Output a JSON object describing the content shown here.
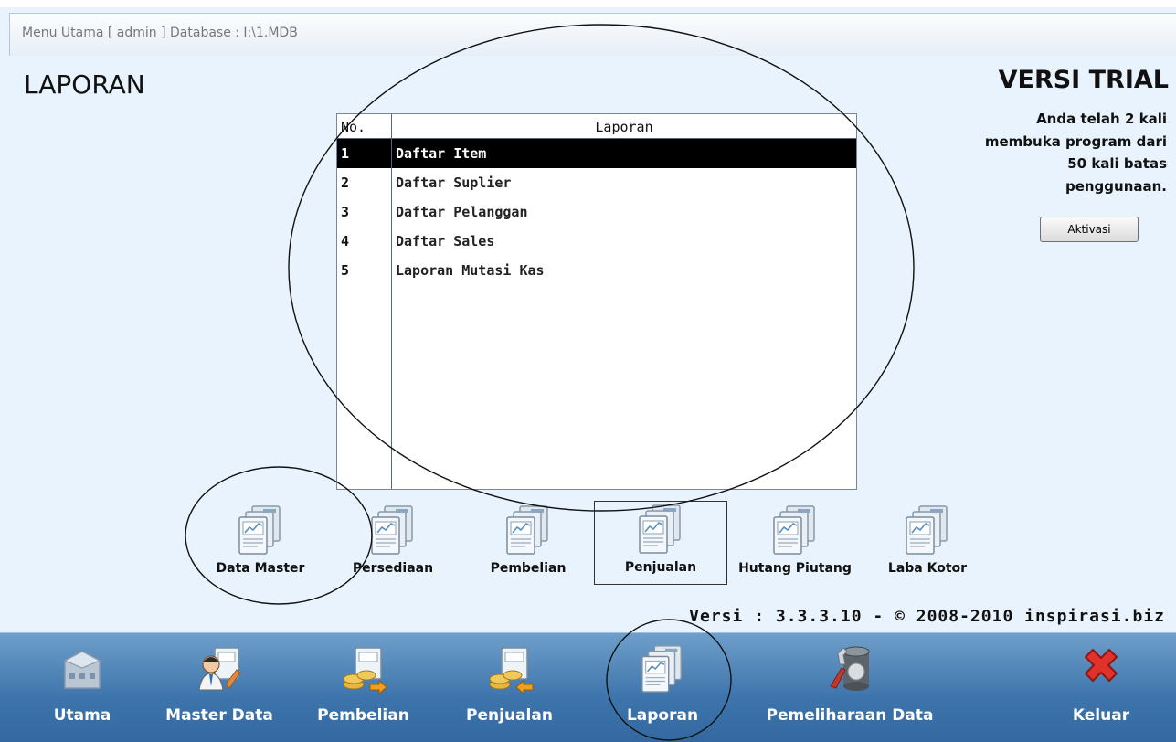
{
  "window": {
    "title": "Menu Utama [ admin ] Database : I:\\1.MDB"
  },
  "page": {
    "title": "LAPORAN"
  },
  "trial": {
    "title": "VERSI TRIAL",
    "line1": "Anda telah 2 kali",
    "line2": "membuka program dari",
    "line3": "50 kali batas",
    "line4": "penggunaan.",
    "button_label": "Aktivasi"
  },
  "report_table": {
    "columns": [
      "No.",
      "Laporan"
    ],
    "rows": [
      {
        "no": "1",
        "name": "Daftar Item",
        "selected": true
      },
      {
        "no": "2",
        "name": "Daftar Suplier"
      },
      {
        "no": "3",
        "name": "Daftar Pelanggan"
      },
      {
        "no": "4",
        "name": "Daftar Sales"
      },
      {
        "no": "5",
        "name": "Laporan Mutasi Kas"
      }
    ]
  },
  "categories": [
    {
      "label": "Data Master",
      "icon": "report-chart-icon"
    },
    {
      "label": "Persediaan",
      "icon": "report-chart-icon"
    },
    {
      "label": "Pembelian",
      "icon": "report-chart-icon"
    },
    {
      "label": "Penjualan",
      "icon": "report-chart-icon",
      "active": true
    },
    {
      "label": "Hutang Piutang",
      "icon": "report-chart-icon"
    },
    {
      "label": "Laba Kotor",
      "icon": "report-chart-icon"
    }
  ],
  "version_text": "Versi : 3.3.3.10 - © 2008-2010 inspirasi.biz",
  "bottom_nav": [
    {
      "label": "Utama",
      "icon": "building-icon"
    },
    {
      "label": "Master Data",
      "icon": "person-document-icon"
    },
    {
      "label": "Pembelian",
      "icon": "coins-document-icon"
    },
    {
      "label": "Penjualan",
      "icon": "coins-document-icon"
    },
    {
      "label": "Laporan",
      "icon": "report-chart-icon"
    },
    {
      "label": "Pemeliharaan Data",
      "icon": "database-tools-icon"
    },
    {
      "label": "Keluar",
      "icon": "close-x-icon"
    }
  ],
  "colors": {
    "bottom_bar": "#3d74ab",
    "selected_row": "#000000",
    "background": "#e9f3fd",
    "keluar_icon": "#e0322a"
  }
}
